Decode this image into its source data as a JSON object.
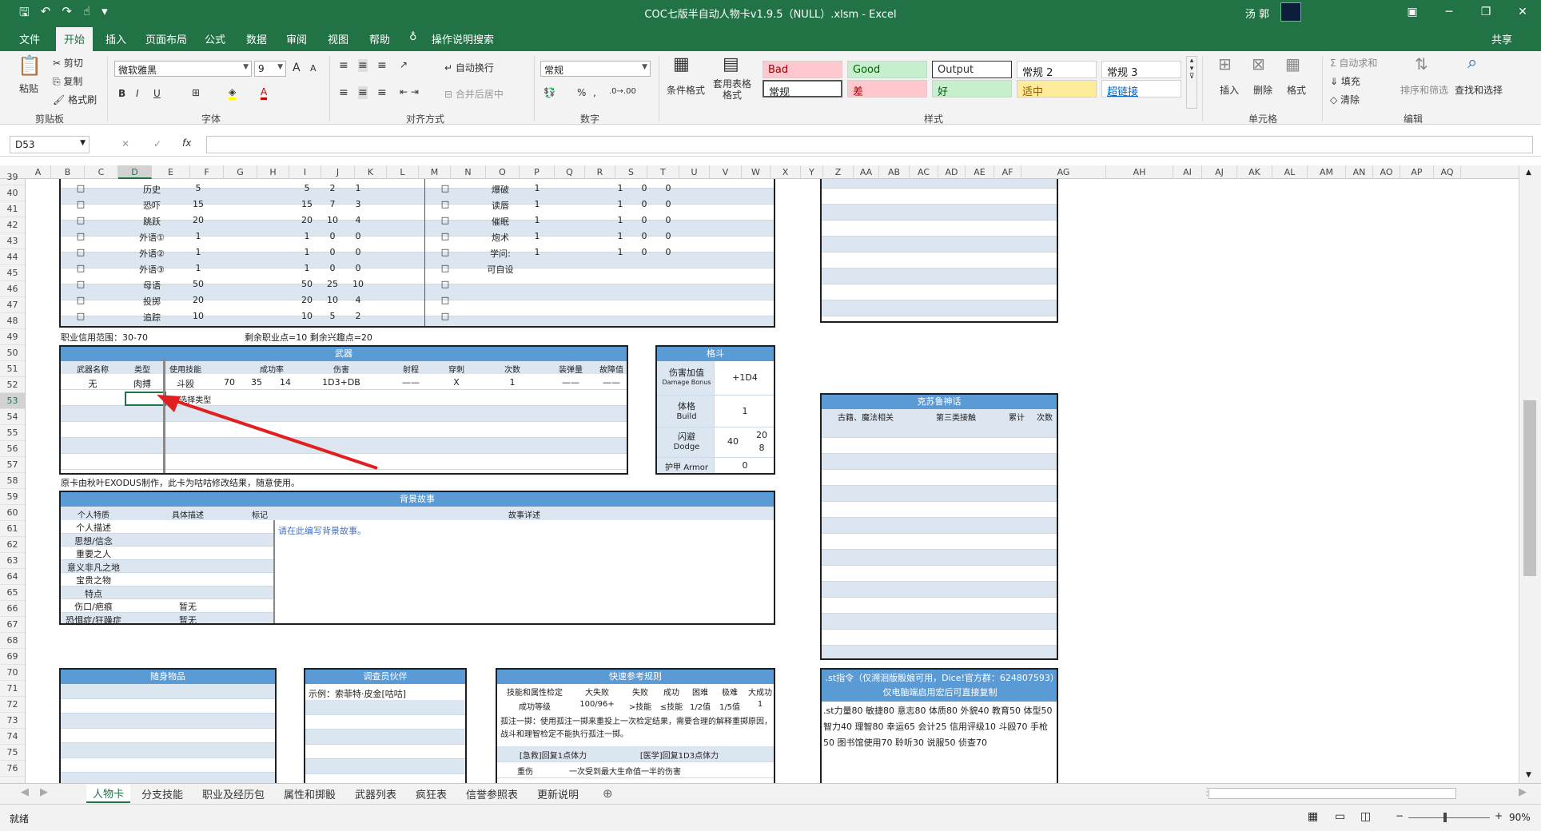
{
  "window": {
    "title": "COC七版半自动人物卡v1.9.5（NULL）.xlsm  -  Excel",
    "user": "汤 郭",
    "controls": [
      "▣",
      "─",
      "❐",
      "✕"
    ]
  },
  "ribbon_tabs": [
    "文件",
    "开始",
    "插入",
    "页面布局",
    "公式",
    "数据",
    "审阅",
    "视图",
    "帮助"
  ],
  "tell_me": "操作说明搜索",
  "share": "共享",
  "clipboard": {
    "paste": "粘贴",
    "cut": "剪切",
    "copy": "复制",
    "format_painter": "格式刷",
    "label": "剪贴板"
  },
  "font": {
    "name": "微软雅黑",
    "size": "9",
    "bold": "B",
    "italic": "I",
    "underline": "U",
    "grow": "A",
    "shrink": "A",
    "label": "字体"
  },
  "alignment": {
    "wrap": "自动换行",
    "merge": "合并后居中",
    "label": "对齐方式"
  },
  "number": {
    "format": "常规",
    "label": "数字"
  },
  "styles": {
    "conditional": "条件格式",
    "table": "套用表格格式",
    "label": "样式",
    "cells": [
      {
        "label": "Bad",
        "bg": "#ffc7ce",
        "fg": "#9c0006"
      },
      {
        "label": "Good",
        "bg": "#c6efce",
        "fg": "#006100"
      },
      {
        "label": "Output",
        "bg": "#ffffff",
        "fg": "#333333"
      },
      {
        "label": "常规 2",
        "bg": "#ffffff",
        "fg": "#222222"
      },
      {
        "label": "常规 3",
        "bg": "#ffffff",
        "fg": "#222222"
      },
      {
        "label": "常规",
        "bg": "#ffffff",
        "fg": "#222222"
      },
      {
        "label": "差",
        "bg": "#ffc7ce",
        "fg": "#9c0006"
      },
      {
        "label": "好",
        "bg": "#c6efce",
        "fg": "#006100"
      },
      {
        "label": "适中",
        "bg": "#ffeb9c",
        "fg": "#9c5700"
      },
      {
        "label": "超链接",
        "bg": "#ffffff",
        "fg": "#0563c1"
      }
    ]
  },
  "cells_group": {
    "insert": "插入",
    "delete": "删除",
    "format": "格式",
    "label": "单元格"
  },
  "editing": {
    "autosum": "自动求和",
    "fill": "填充",
    "clear": "清除",
    "sort": "排序和筛选",
    "find": "查找和选择",
    "label": "编辑"
  },
  "name_box": "D53",
  "formula_icons": {
    "cancel": "✕",
    "enter": "✓",
    "fx": "fx"
  },
  "columns": [
    "A",
    "B",
    "C",
    "D",
    "E",
    "F",
    "G",
    "H",
    "I",
    "J",
    "K",
    "L",
    "M",
    "N",
    "O",
    "P",
    "Q",
    "R",
    "S",
    "T",
    "U",
    "V",
    "W",
    "X",
    "Y",
    "Z",
    "AA",
    "AB",
    "AC",
    "AD",
    "AE",
    "AF",
    "AG",
    "AH",
    "AI",
    "AJ",
    "AK",
    "AL",
    "AM",
    "AN",
    "AO",
    "AP",
    "AQ"
  ],
  "rows": [
    "39",
    "40",
    "41",
    "42",
    "43",
    "44",
    "45",
    "46",
    "47",
    "48",
    "49",
    "50",
    "51",
    "52",
    "53",
    "54",
    "55",
    "56",
    "57",
    "58",
    "59",
    "60",
    "61",
    "62",
    "63",
    "64",
    "65",
    "66",
    "67",
    "68",
    "69",
    "70",
    "71",
    "72",
    "73",
    "74",
    "75",
    "76"
  ],
  "skills_left": [
    {
      "check": "□",
      "name": "历史",
      "base": "5",
      "total": "5",
      "half": "2",
      "fifth": "1"
    },
    {
      "check": "□",
      "name": "恐吓",
      "base": "15",
      "total": "15",
      "half": "7",
      "fifth": "3"
    },
    {
      "check": "□",
      "name": "跳跃",
      "base": "20",
      "total": "20",
      "half": "10",
      "fifth": "4"
    },
    {
      "check": "□",
      "name": "外语①",
      "base": "1",
      "total": "1",
      "half": "0",
      "fifth": "0"
    },
    {
      "check": "□",
      "name": "外语②",
      "base": "1",
      "total": "1",
      "half": "0",
      "fifth": "0"
    },
    {
      "check": "□",
      "name": "外语③",
      "base": "1",
      "total": "1",
      "half": "0",
      "fifth": "0"
    },
    {
      "check": "□",
      "name": "母语",
      "base": "50",
      "total": "50",
      "half": "25",
      "fifth": "10"
    },
    {
      "check": "□",
      "name": "投掷",
      "base": "20",
      "total": "20",
      "half": "10",
      "fifth": "4"
    },
    {
      "check": "□",
      "name": "追踪",
      "base": "10",
      "total": "10",
      "half": "5",
      "fifth": "2"
    }
  ],
  "skills_right": [
    {
      "check": "□",
      "name": "爆破",
      "base": "1",
      "total": "1",
      "half": "0",
      "fifth": "0"
    },
    {
      "check": "□",
      "name": "读唇",
      "base": "1",
      "total": "1",
      "half": "0",
      "fifth": "0"
    },
    {
      "check": "□",
      "name": "催眠",
      "base": "1",
      "total": "1",
      "half": "0",
      "fifth": "0"
    },
    {
      "check": "□",
      "name": "炮术",
      "base": "1",
      "total": "1",
      "half": "0",
      "fifth": "0"
    },
    {
      "check": "□",
      "name": "学问:",
      "base": "1",
      "total": "1",
      "half": "0",
      "fifth": "0"
    },
    {
      "check": "□",
      "name": "可自设",
      "base": "",
      "total": "",
      "half": "",
      "fifth": ""
    },
    {
      "check": "□",
      "name": "",
      "base": "",
      "total": "",
      "half": "",
      "fifth": ""
    },
    {
      "check": "□",
      "name": "",
      "base": "",
      "total": "",
      "half": "",
      "fifth": ""
    },
    {
      "check": "□",
      "name": "",
      "base": "",
      "total": "",
      "half": "",
      "fifth": ""
    }
  ],
  "credit_note": "职业信用范围：30-70",
  "points_note": "剩余职业点=10   剩余兴趣点=20",
  "weapons": {
    "title": "武器",
    "headers": [
      "武器名称",
      "类型",
      "使用技能",
      "成功率",
      "伤害",
      "射程",
      "穿刺",
      "次数",
      "装弹量",
      "故障值"
    ],
    "row": {
      "name": "无",
      "type": "肉搏",
      "skill": "斗殴",
      "r1": "70",
      "r2": "35",
      "r3": "14",
      "dmg": "1D3+DB",
      "range": "——",
      "impale": "X",
      "times": "1",
      "ammo": "——",
      "malf": "——"
    },
    "dropdown": "选择类型"
  },
  "combat": {
    "title": "格斗",
    "db_label": "伤害加值",
    "db_sub": "Damage Bonus",
    "db": "+1D4",
    "build_label": "体格",
    "build_sub": "Build",
    "build": "1",
    "dodge_label": "闪避",
    "dodge_sub": "Dodge",
    "dodge": "40",
    "dodge_half": "20",
    "dodge_fifth": "8",
    "armor_label": "护甲 Armor",
    "armor": "0"
  },
  "footnote": "原卡由秋叶EXODUS制作，此卡为咕咕修改结果，随意使用。",
  "background": {
    "title": "背景故事",
    "headers": [
      "个人特质",
      "具体描述",
      "标记",
      "故事详述"
    ],
    "items": [
      {
        "trait": "个人描述",
        "desc": ""
      },
      {
        "trait": "思想/信念",
        "desc": ""
      },
      {
        "trait": "重要之人",
        "desc": ""
      },
      {
        "trait": "意义非凡之地",
        "desc": ""
      },
      {
        "trait": "宝贵之物",
        "desc": ""
      },
      {
        "trait": "特点",
        "desc": ""
      },
      {
        "trait": "伤口/疤痕",
        "desc": "暂无"
      },
      {
        "trait": "恐惧症/狂躁症",
        "desc": "暂无"
      }
    ],
    "story": "请在此编写背景故事。"
  },
  "mythos": {
    "title": "克苏鲁神话",
    "headers": [
      "古籍、魔法相关",
      "第三类接触",
      "累计",
      "次数"
    ]
  },
  "items_box": {
    "title": "随身物品"
  },
  "companions": {
    "title": "调查员伙伴",
    "example": "示例：索菲特·皮金[咕咕]"
  },
  "rules": {
    "title": "快速参考规则",
    "headers": [
      "技能和属性检定",
      "大失败",
      "失败",
      "成功",
      "困难",
      "极难",
      "大成功"
    ],
    "row_label": "成功等级",
    "row": [
      "100/96+",
      ">技能",
      "≤技能",
      "1/2值",
      "1/5值",
      "1"
    ],
    "note": "孤注一掷：使用孤注一掷来重投上一次检定结果，需要合理的解释重掷原因，战斗和理智检定不能执行孤注一掷。",
    "heal1": "[急救]回复1点体力",
    "heal2": "[医学]回复1D3点体力",
    "major_label": "重伤",
    "major": "一次受到最大生命值一半的伤害"
  },
  "st_box": {
    "title": ".st指令（仅溯洄版骰娘可用，Dice!官方群：624807593）仅电脑端启用宏后可直接复制",
    "content": ".st力量80 敏捷80 意志80 体质80 外貌40 教育50 体型50 智力40 理智80 幸运65 会计25 信用评级10 斗殴70 手枪50 图书馆使用70 聆听30 说服50 侦查70"
  },
  "sheet_tabs": [
    "人物卡",
    "分支技能",
    "职业及经历包",
    "属性和掷骰",
    "武器列表",
    "疯狂表",
    "信誉参照表",
    "更新说明"
  ],
  "status": {
    "ready": "就绪",
    "zoom": "90%"
  }
}
